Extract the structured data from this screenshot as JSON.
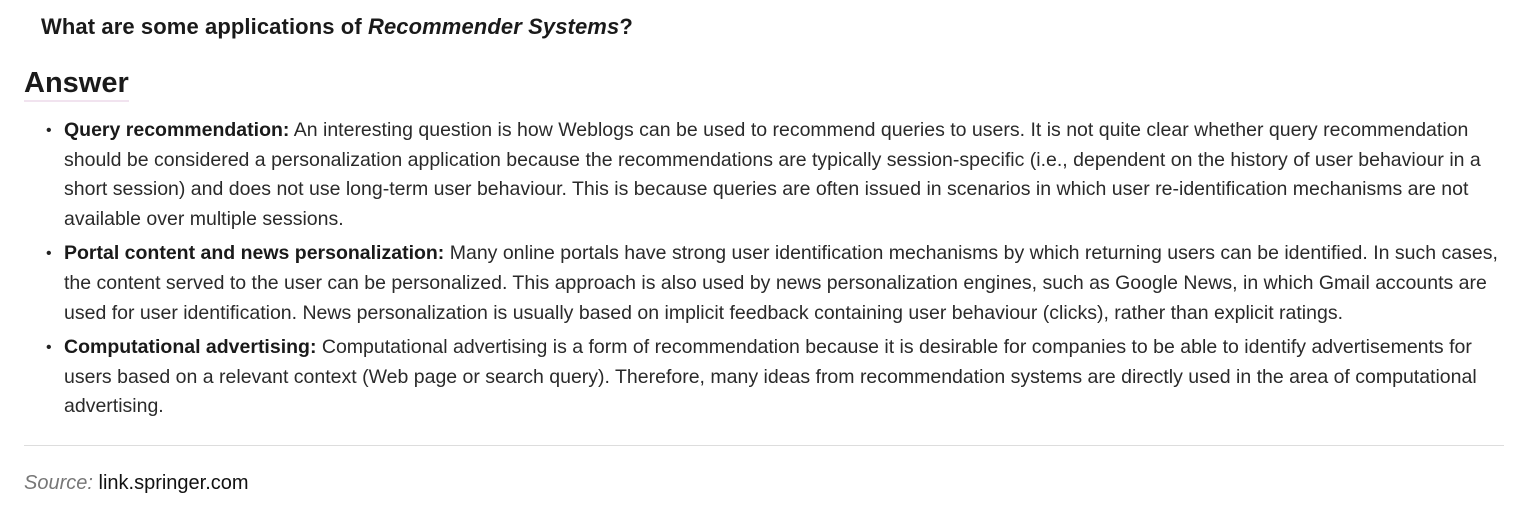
{
  "question": {
    "prefix": "What are some applications of ",
    "emphasis": "Recommender Systems",
    "suffix": "?"
  },
  "answer": {
    "heading": "Answer",
    "items": [
      {
        "term": "Query recommendation:",
        "text": " An interesting question is how Weblogs can be used to recommend queries to users. It is not quite clear whether query recommendation should be considered a personalization application because the recommendations are typically session-specific (i.e., dependent on the history of user behaviour in a short session) and does not use long-term user behaviour. This is because queries are often issued in scenarios in which user re-identification mechanisms are not available over multiple sessions."
      },
      {
        "term": "Portal content and news personalization:",
        "text": " Many online portals have strong user identification mechanisms by which returning users can be identified. In such cases, the content served to the user can be personalized. This approach is also used by news personalization engines, such as Google News, in which Gmail accounts are used for user identification. News personalization is usually based on implicit feedback containing user behaviour (clicks), rather than explicit ratings."
      },
      {
        "term": "Computational advertising:",
        "text": " Computational advertising is a form of recommendation because it is desirable for companies to be able to identify advertisements for users based on a relevant context (Web page or search query). Therefore, many ideas from recommendation systems are directly used in the area of computational advertising."
      }
    ]
  },
  "source": {
    "label": "Source:",
    "value": "link.springer.com"
  }
}
